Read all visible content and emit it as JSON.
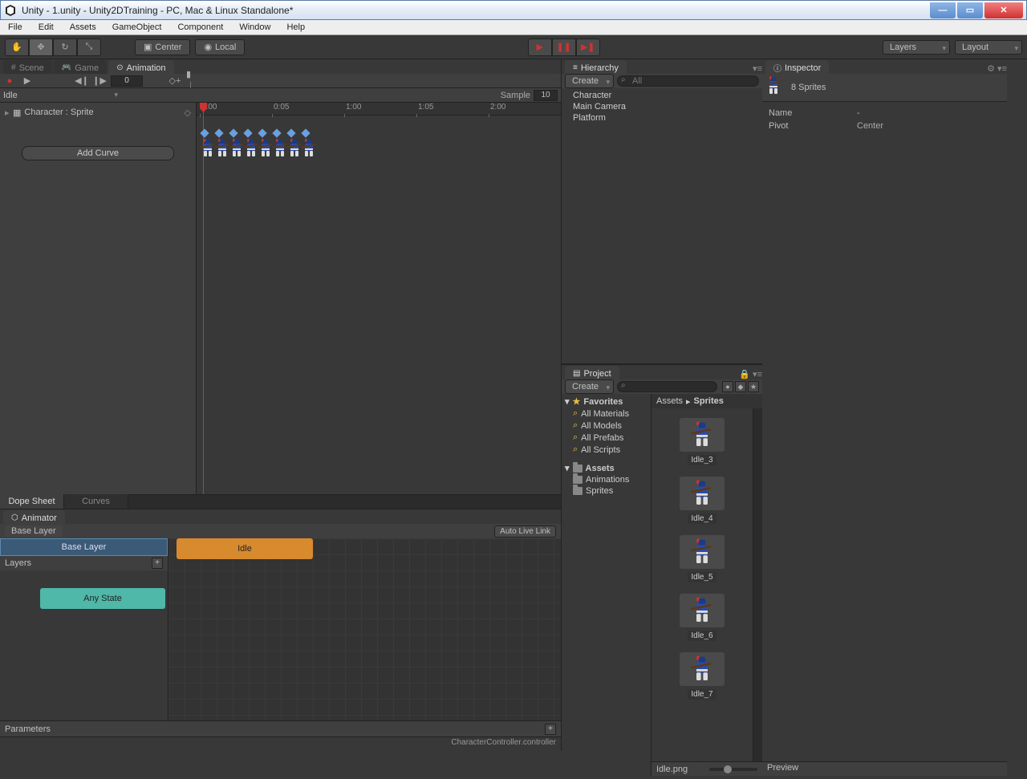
{
  "window": {
    "title": "Unity - 1.unity - Unity2DTraining - PC, Mac & Linux Standalone*"
  },
  "menubar": [
    "File",
    "Edit",
    "Assets",
    "GameObject",
    "Component",
    "Window",
    "Help"
  ],
  "toolbar": {
    "center": "Center",
    "local": "Local",
    "layers": "Layers",
    "layout": "Layout"
  },
  "tabs_anim": {
    "scene": "Scene",
    "game": "Game",
    "animation": "Animation"
  },
  "animation": {
    "frame": "0",
    "clip": "Idle",
    "sample_label": "Sample",
    "sample_value": "10",
    "property": "Character : Sprite",
    "add_curve": "Add Curve",
    "ticks": [
      "0:00",
      "0:05",
      "1:00",
      "1:05",
      "2:00"
    ],
    "keyframe_count": 8,
    "dope": "Dope Sheet",
    "curves": "Curves"
  },
  "animator": {
    "tab": "Animator",
    "breadcrumb": "Base Layer",
    "auto_live": "Auto Live Link",
    "layer_item": "Base Layer",
    "layers_label": "Layers",
    "state_idle": "Idle",
    "state_any": "Any State",
    "parameters": "Parameters",
    "status": "CharacterController.controller"
  },
  "hierarchy": {
    "tab": "Hierarchy",
    "create": "Create",
    "search_ph": "All",
    "items": [
      "Character",
      "Main Camera",
      "Platform"
    ]
  },
  "project": {
    "tab": "Project",
    "create": "Create",
    "favorites_label": "Favorites",
    "favorites": [
      "All Materials",
      "All Models",
      "All Prefabs",
      "All Scripts"
    ],
    "assets_label": "Assets",
    "assets": [
      "Animations",
      "Sprites"
    ],
    "breadcrumb": [
      "Assets",
      "Sprites"
    ],
    "grid": [
      "Idle_3",
      "Idle_4",
      "Idle_5",
      "Idle_6",
      "Idle_7"
    ],
    "footer_file": "Idle.png"
  },
  "inspector": {
    "tab": "Inspector",
    "title": "8 Sprites",
    "rows": [
      {
        "k": "Name",
        "v": "-"
      },
      {
        "k": "Pivot",
        "v": "Center"
      }
    ],
    "preview": "Preview"
  }
}
